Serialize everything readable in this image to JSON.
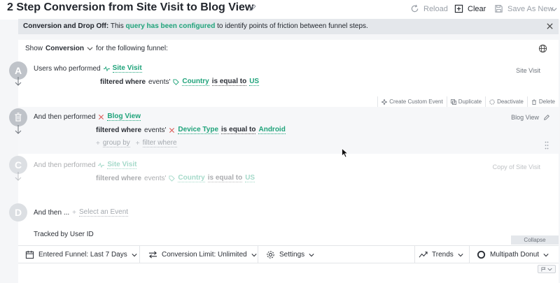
{
  "header": {
    "title": "2 Step Conversion from Site Visit to Blog View",
    "reload_label": "Reload",
    "clear_label": "Clear",
    "save_as_new_label": "Save As New"
  },
  "banner": {
    "prefix": "Conversion and Drop Off:",
    "text_before": "This",
    "link_text": "query has been configured",
    "text_after": "to identify points of friction between funnel steps."
  },
  "show_row": {
    "show_label": "Show",
    "metric": "Conversion",
    "suffix": "for the following funnel:"
  },
  "steps": [
    {
      "letter": "A",
      "lead": "Users who performed",
      "event": "Site Visit",
      "filter_lead": "filtered where",
      "filter_scope": "events'",
      "property": "Country",
      "operator": "is equal to",
      "value": "US",
      "right_label": "Site Visit"
    },
    {
      "lead": "And then performed",
      "event": "Blog View",
      "filter_lead": "filtered where",
      "filter_scope": "events'",
      "property": "Device Type",
      "operator": "is equal to",
      "value": "Android",
      "group_by_label": "group by",
      "filter_where_label": "filter where",
      "right_label": "Blog View"
    },
    {
      "letter": "C",
      "lead": "And then performed",
      "event": "Site Visit",
      "filter_lead": "filtered where",
      "filter_scope": "events'",
      "property": "Country",
      "operator": "is equal to",
      "value": "US",
      "right_label": "Copy of Site Visit"
    },
    {
      "letter": "D",
      "lead": "And then ...",
      "placeholder": "Select an Event"
    }
  ],
  "step_actions": [
    "Create Custom Event",
    "Duplicate",
    "Deactivate",
    "Delete"
  ],
  "tracked_by": "Tracked by User ID",
  "collapse_label": "Collapse",
  "bottom_bar": {
    "entered_funnel": "Entered Funnel: Last 7 Days",
    "conversion_limit": "Conversion Limit: Unlimited",
    "settings": "Settings",
    "trends": "Trends",
    "multipath": "Multipath Donut"
  },
  "colors": {
    "accent_green": "#1fa37a",
    "circle_gray": "#bfc3c9"
  }
}
